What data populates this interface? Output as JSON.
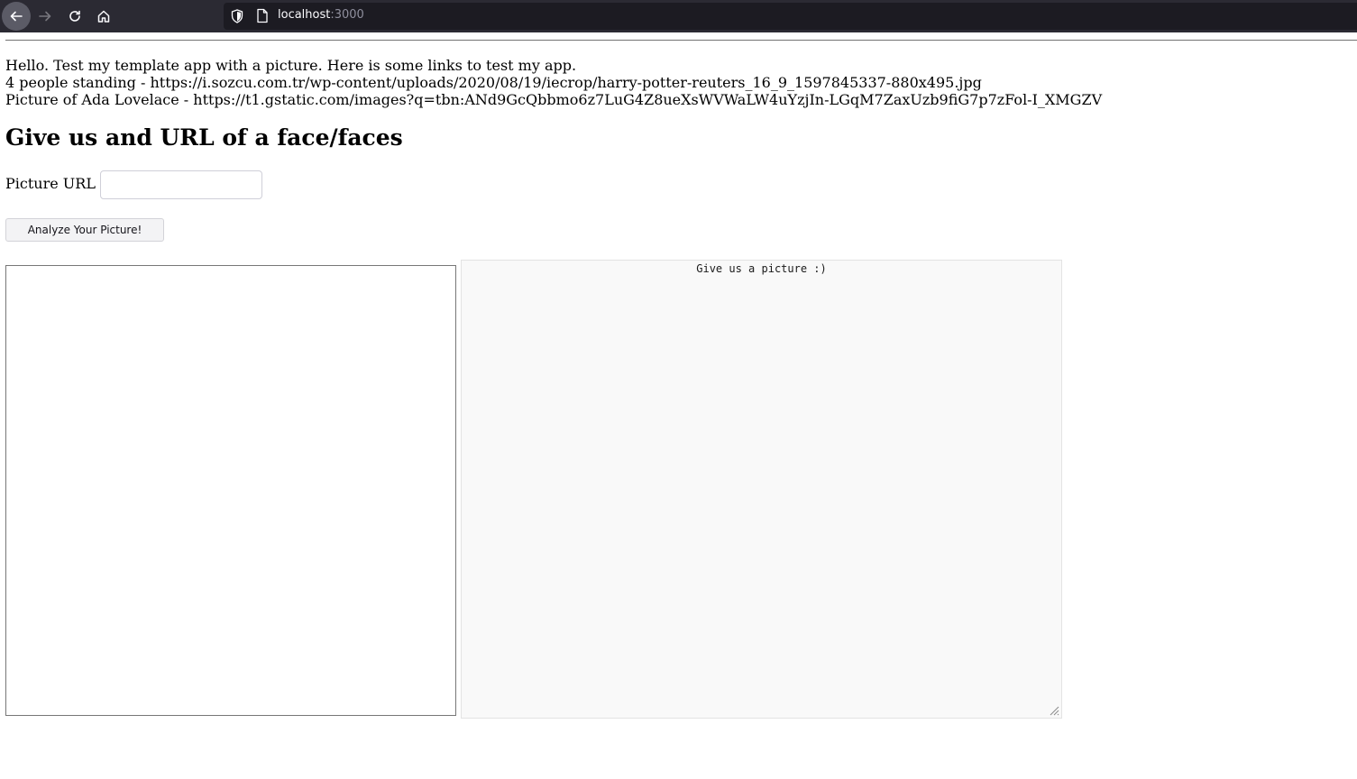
{
  "browser": {
    "url_host": "localhost",
    "url_port": ":3000",
    "icons": [
      "back-arrow-icon",
      "forward-arrow-icon",
      "reload-icon",
      "home-icon",
      "shield-icon",
      "page-icon"
    ]
  },
  "intro": {
    "line1": "Hello. Test my template app with a picture. Here is some links to test my app.",
    "line2": "4 people standing - https://i.sozcu.com.tr/wp-content/uploads/2020/08/19/iecrop/harry-potter-reuters_16_9_1597845337-880x495.jpg",
    "line3": "Picture of Ada Lovelace - https://t1.gstatic.com/images?q=tbn:ANd9GcQbbmo6z7LuG4Z8ueXsWVWaLW4uYzjIn-LGqM7ZaxUzb9fiG7p7zFol-I_XMGZV"
  },
  "form": {
    "heading": "Give us and URL of a face/faces",
    "url_label": "Picture URL",
    "url_value": "",
    "url_placeholder": "",
    "submit_label": "Analyze Your Picture!"
  },
  "result": {
    "text": "Give us a picture :)"
  },
  "colors": {
    "chrome_bg": "#2b2a33",
    "urlbar_bg": "#1c1b22",
    "result_bg": "#f9f9f9"
  }
}
